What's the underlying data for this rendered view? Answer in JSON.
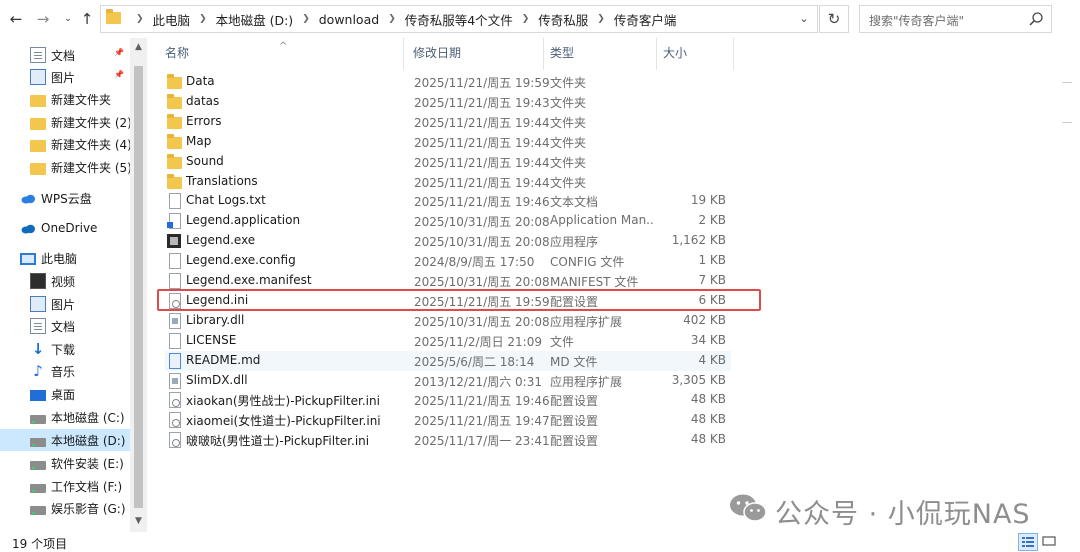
{
  "address_bar": {
    "breadcrumbs": [
      "此电脑",
      "本地磁盘 (D:)",
      "download",
      "传奇私服等4个文件",
      "传奇私服",
      "传奇客户端"
    ]
  },
  "search": {
    "placeholder": "搜索\"传奇客户端\""
  },
  "nav": {
    "items": [
      {
        "label": "文档",
        "icon": "document-icon",
        "pinned": true
      },
      {
        "label": "图片",
        "icon": "pictures-icon",
        "pinned": true
      },
      {
        "label": "新建文件夹",
        "icon": "folder-icon"
      },
      {
        "label": "新建文件夹 (2)",
        "icon": "folder-icon"
      },
      {
        "label": "新建文件夹 (4)",
        "icon": "folder-icon"
      },
      {
        "label": "新建文件夹 (5)",
        "icon": "folder-icon"
      },
      {
        "label": "WPS云盘",
        "icon": "wps-cloud-icon"
      },
      {
        "label": "OneDrive",
        "icon": "onedrive-icon"
      },
      {
        "label": "此电脑",
        "icon": "this-pc-icon"
      },
      {
        "label": "视频",
        "icon": "videos-icon"
      },
      {
        "label": "图片",
        "icon": "pictures-icon"
      },
      {
        "label": "文档",
        "icon": "document-icon"
      },
      {
        "label": "下载",
        "icon": "downloads-icon"
      },
      {
        "label": "音乐",
        "icon": "music-icon"
      },
      {
        "label": "桌面",
        "icon": "desktop-icon"
      },
      {
        "label": "本地磁盘 (C:)",
        "icon": "drive-icon"
      },
      {
        "label": "本地磁盘 (D:)",
        "icon": "drive-icon",
        "selected": true
      },
      {
        "label": "软件安装 (E:)",
        "icon": "drive-icon"
      },
      {
        "label": "工作文档 (F:)",
        "icon": "drive-icon"
      },
      {
        "label": "娱乐影音 (G:)",
        "icon": "drive-icon"
      }
    ]
  },
  "columns": {
    "name": "名称",
    "date": "修改日期",
    "type": "类型",
    "size": "大小"
  },
  "files": [
    {
      "name": "Data",
      "date": "2025/11/21/周五 19:59",
      "type": "文件夹",
      "size": "",
      "kind": "folder"
    },
    {
      "name": "datas",
      "date": "2025/11/21/周五 19:43",
      "type": "文件夹",
      "size": "",
      "kind": "folder"
    },
    {
      "name": "Errors",
      "date": "2025/11/21/周五 19:44",
      "type": "文件夹",
      "size": "",
      "kind": "folder"
    },
    {
      "name": "Map",
      "date": "2025/11/21/周五 19:44",
      "type": "文件夹",
      "size": "",
      "kind": "folder"
    },
    {
      "name": "Sound",
      "date": "2025/11/21/周五 19:44",
      "type": "文件夹",
      "size": "",
      "kind": "folder"
    },
    {
      "name": "Translations",
      "date": "2025/11/21/周五 19:44",
      "type": "文件夹",
      "size": "",
      "kind": "folder"
    },
    {
      "name": "Chat Logs.txt",
      "date": "2025/11/21/周五 19:46",
      "type": "文本文档",
      "size": "19 KB",
      "kind": "file"
    },
    {
      "name": "Legend.application",
      "date": "2025/10/31/周五 20:08",
      "type": "Application Man...",
      "size": "2 KB",
      "kind": "app"
    },
    {
      "name": "Legend.exe",
      "date": "2025/10/31/周五 20:08",
      "type": "应用程序",
      "size": "1,162 KB",
      "kind": "exe"
    },
    {
      "name": "Legend.exe.config",
      "date": "2024/8/9/周五 17:50",
      "type": "CONFIG 文件",
      "size": "1 KB",
      "kind": "file"
    },
    {
      "name": "Legend.exe.manifest",
      "date": "2025/10/31/周五 20:08",
      "type": "MANIFEST 文件",
      "size": "7 KB",
      "kind": "file"
    },
    {
      "name": "Legend.ini",
      "date": "2025/11/21/周五 19:59",
      "type": "配置设置",
      "size": "6 KB",
      "kind": "ini",
      "highlighted": true
    },
    {
      "name": "Library.dll",
      "date": "2025/10/31/周五 20:08",
      "type": "应用程序扩展",
      "size": "402 KB",
      "kind": "dll"
    },
    {
      "name": "LICENSE",
      "date": "2025/11/2/周日 21:09",
      "type": "文件",
      "size": "34 KB",
      "kind": "file"
    },
    {
      "name": "README.md",
      "date": "2025/5/6/周二 18:14",
      "type": "MD 文件",
      "size": "4 KB",
      "kind": "md",
      "hover": true
    },
    {
      "name": "SlimDX.dll",
      "date": "2013/12/21/周六 0:31",
      "type": "应用程序扩展",
      "size": "3,305 KB",
      "kind": "dll"
    },
    {
      "name": "xiaokan(男性战士)-PickupFilter.ini",
      "date": "2025/11/21/周五 19:46",
      "type": "配置设置",
      "size": "48 KB",
      "kind": "ini"
    },
    {
      "name": "xiaomei(女性道士)-PickupFilter.ini",
      "date": "2025/11/21/周五 19:47",
      "type": "配置设置",
      "size": "48 KB",
      "kind": "ini"
    },
    {
      "name": "啵啵哒(男性道士)-PickupFilter.ini",
      "date": "2025/11/17/周一 23:41",
      "type": "配置设置",
      "size": "48 KB",
      "kind": "ini"
    }
  ],
  "status": {
    "count": "19 个项目"
  },
  "watermark": {
    "text": "公众号 · 小侃玩NAS"
  },
  "colors": {
    "highlight_box": "#e04a4a",
    "selected_nav": "#cce8ff",
    "folder": "#f3c64e"
  }
}
